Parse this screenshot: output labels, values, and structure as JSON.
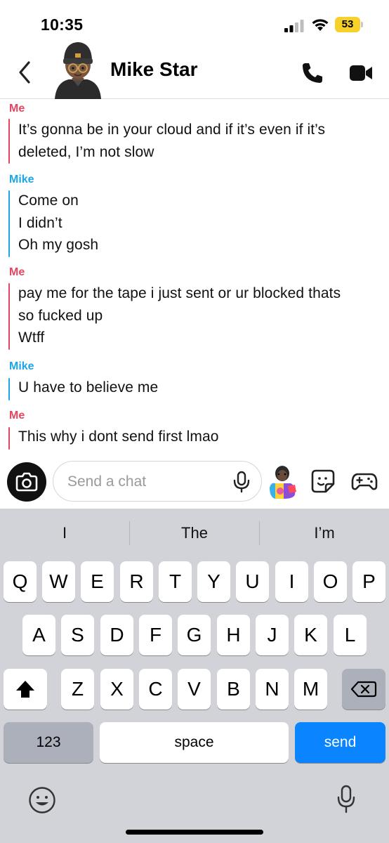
{
  "status_bar": {
    "time": "10:35",
    "battery": "53"
  },
  "header": {
    "contact_name": "Mike Star"
  },
  "messages": [
    {
      "sender": "Me",
      "type": "me",
      "lines": [
        "It’s gonna be in your cloud and if it’s even if it’s",
        "deleted, I’m not slow"
      ]
    },
    {
      "sender": "Mike",
      "type": "mike",
      "lines": [
        "Come on",
        "I didn’t",
        "Oh my gosh"
      ]
    },
    {
      "sender": "Me",
      "type": "me",
      "lines": [
        "pay me for the tape i just sent or ur blocked thats",
        "so fucked up",
        "Wtff"
      ]
    },
    {
      "sender": "Mike",
      "type": "mike",
      "lines": [
        "U have to believe me"
      ]
    },
    {
      "sender": "Me",
      "type": "me",
      "lines": [
        "This why i dont send first lmao"
      ]
    }
  ],
  "composer": {
    "placeholder": "Send a chat"
  },
  "keyboard": {
    "suggestions": [
      "I",
      "The",
      "I’m"
    ],
    "row1": [
      "Q",
      "W",
      "E",
      "R",
      "T",
      "Y",
      "U",
      "I",
      "O",
      "P"
    ],
    "row2": [
      "A",
      "S",
      "D",
      "F",
      "G",
      "H",
      "J",
      "K",
      "L"
    ],
    "row3": [
      "Z",
      "X",
      "C",
      "V",
      "B",
      "N",
      "M"
    ],
    "numbers_label": "123",
    "space_label": "space",
    "send_label": "send"
  },
  "colors": {
    "me": "#e34660",
    "mike": "#1ea5e6",
    "send_key": "#0a84ff",
    "battery": "#f7d02a"
  }
}
